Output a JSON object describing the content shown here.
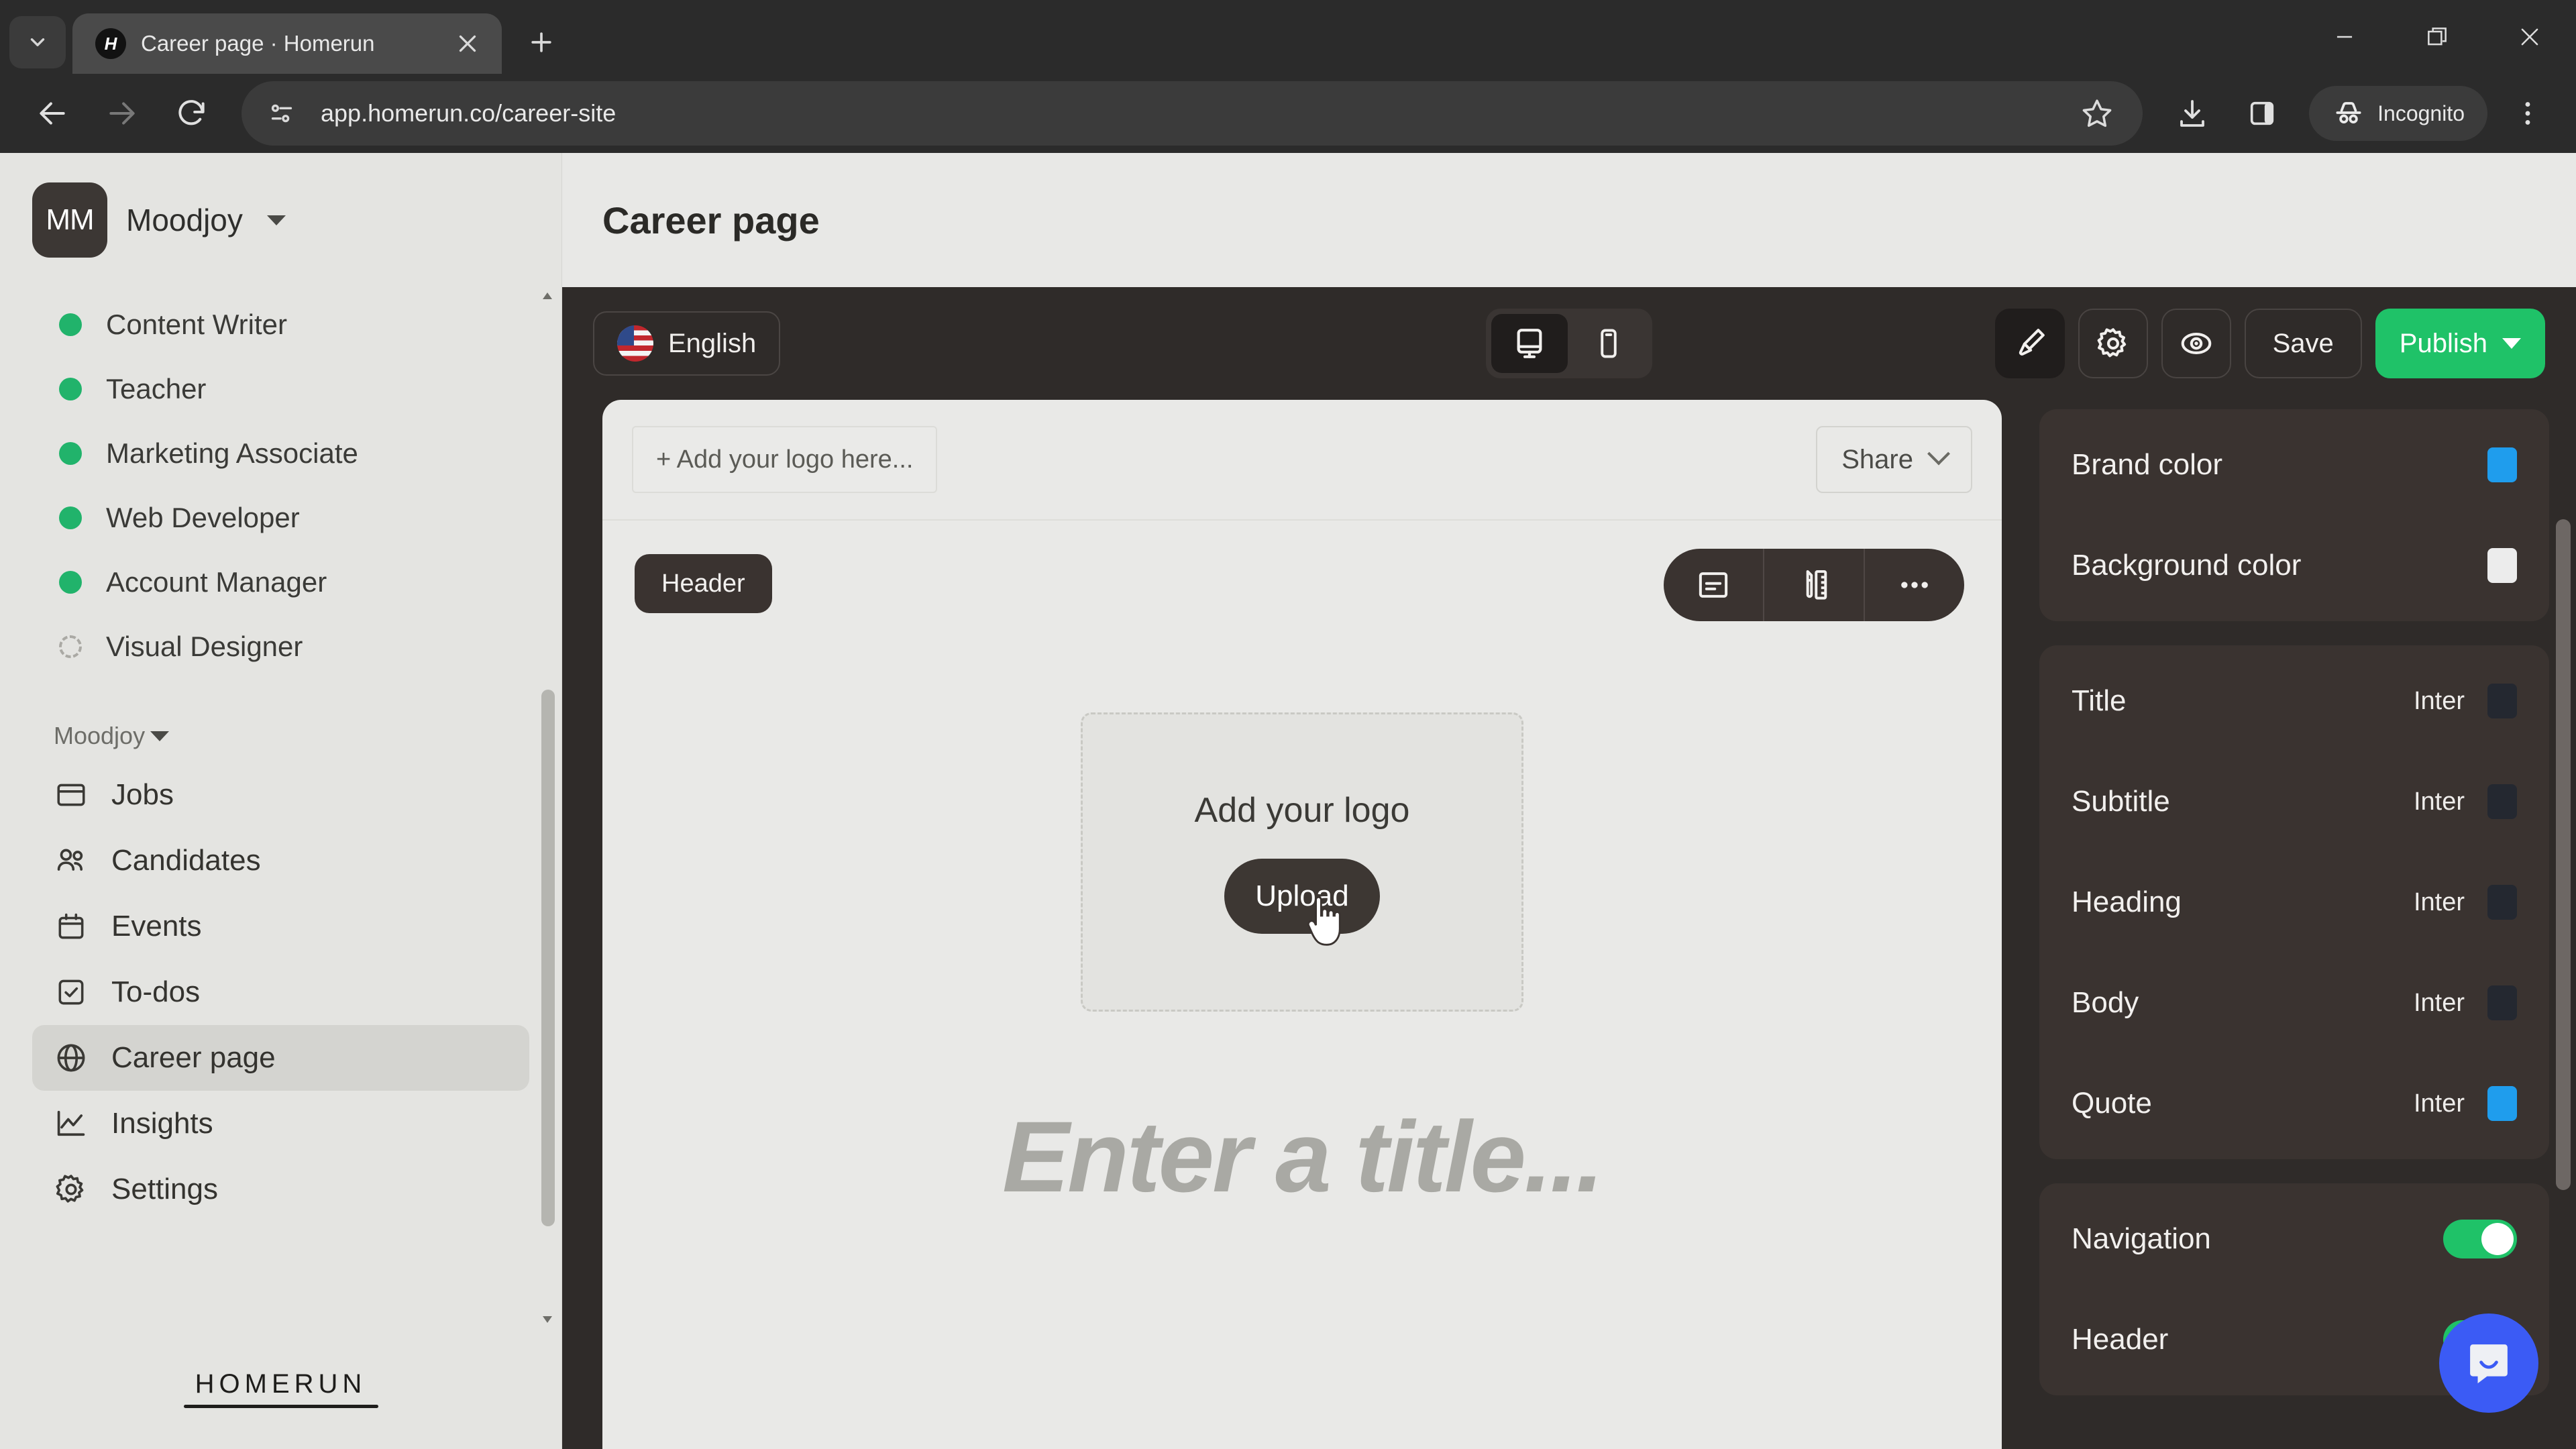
{
  "browser": {
    "tab": {
      "title": "Career page · Homerun",
      "favicon_letter": "H"
    },
    "tab_search_icon": "chevron-down-icon",
    "new_tab_label": "+",
    "window_controls": {
      "minimize": "minimize-icon",
      "maximize": "maximize-icon",
      "close": "close-icon"
    },
    "nav": {
      "back": "back-arrow-icon",
      "forward": "forward-arrow-icon",
      "reload": "reload-icon"
    },
    "omnibox": {
      "url": "app.homerun.co/career-site",
      "site_info_icon": "page-info-icon",
      "bookmark_icon": "star-icon"
    },
    "actions": {
      "download_icon": "download-icon",
      "sidepanel_icon": "side-panel-icon",
      "incognito_label": "Incognito",
      "incognito_icon": "incognito-hat-icon",
      "menu_icon": "kebab-menu-icon"
    }
  },
  "sidebar": {
    "workspace": {
      "initials": "MM",
      "name": "Moodjoy"
    },
    "jobs": [
      {
        "label": "Content Writer",
        "status": "published"
      },
      {
        "label": "Teacher",
        "status": "published"
      },
      {
        "label": "Marketing Associate",
        "status": "published"
      },
      {
        "label": "Web Developer",
        "status": "published"
      },
      {
        "label": "Account Manager",
        "status": "published"
      },
      {
        "label": "Visual Designer",
        "status": "draft"
      }
    ],
    "section_label": "Moodjoy",
    "nav_items": [
      {
        "label": "Jobs",
        "icon": "browser-window-icon",
        "active": false
      },
      {
        "label": "Candidates",
        "icon": "people-icon",
        "active": false
      },
      {
        "label": "Events",
        "icon": "calendar-icon",
        "active": false
      },
      {
        "label": "To-dos",
        "icon": "checkbox-icon",
        "active": false
      },
      {
        "label": "Career page",
        "icon": "globe-icon",
        "active": true
      },
      {
        "label": "Insights",
        "icon": "line-chart-icon",
        "active": false
      },
      {
        "label": "Settings",
        "icon": "gear-icon",
        "active": false
      }
    ],
    "footer_logo": "HOMERUN"
  },
  "page": {
    "title": "Career page"
  },
  "editor_toolbar": {
    "language": {
      "label": "English",
      "flag": "us-flag-icon"
    },
    "devices": [
      {
        "name": "desktop",
        "icon": "desktop-icon",
        "active": true
      },
      {
        "name": "mobile",
        "icon": "mobile-icon",
        "active": false
      }
    ],
    "actions": [
      {
        "name": "design",
        "icon": "paintbrush-icon",
        "active": true
      },
      {
        "name": "settings",
        "icon": "gear-icon",
        "active": false
      },
      {
        "name": "preview",
        "icon": "eye-icon",
        "active": false
      }
    ],
    "save_label": "Save",
    "publish_label": "Publish",
    "publish_caret": "caret-down-icon"
  },
  "canvas": {
    "logo_slot_label": "+ Add your logo here...",
    "share_label": "Share",
    "block_badge": "Header",
    "block_toolbar": [
      {
        "name": "layout",
        "icon": "layout-icon"
      },
      {
        "name": "style",
        "icon": "pencil-ruler-icon"
      },
      {
        "name": "more",
        "icon": "ellipsis-icon"
      }
    ],
    "logo_drop": {
      "title": "Add your logo",
      "button": "Upload"
    },
    "title_placeholder": "Enter a title..."
  },
  "settings_panel": {
    "colors": [
      {
        "label": "Brand color",
        "value": "#1f9ded"
      },
      {
        "label": "Background color",
        "value": "#ececec"
      }
    ],
    "typography": [
      {
        "label": "Title",
        "font": "Inter",
        "color": "#242830"
      },
      {
        "label": "Subtitle",
        "font": "Inter",
        "color": "#242830"
      },
      {
        "label": "Heading",
        "font": "Inter",
        "color": "#242830"
      },
      {
        "label": "Body",
        "font": "Inter",
        "color": "#242830"
      },
      {
        "label": "Quote",
        "font": "Inter",
        "color": "#1f9ded"
      }
    ],
    "sections": [
      {
        "label": "Navigation",
        "enabled": true
      },
      {
        "label": "Header",
        "enabled": true
      }
    ]
  },
  "widgets": {
    "intercom_icon": "intercom-chat-icon"
  },
  "colors": {
    "accent_green": "#1fc268",
    "brand_blue": "#1f9ded",
    "editor_bg": "#2f2b29",
    "panel_bg": "#3a3330"
  }
}
